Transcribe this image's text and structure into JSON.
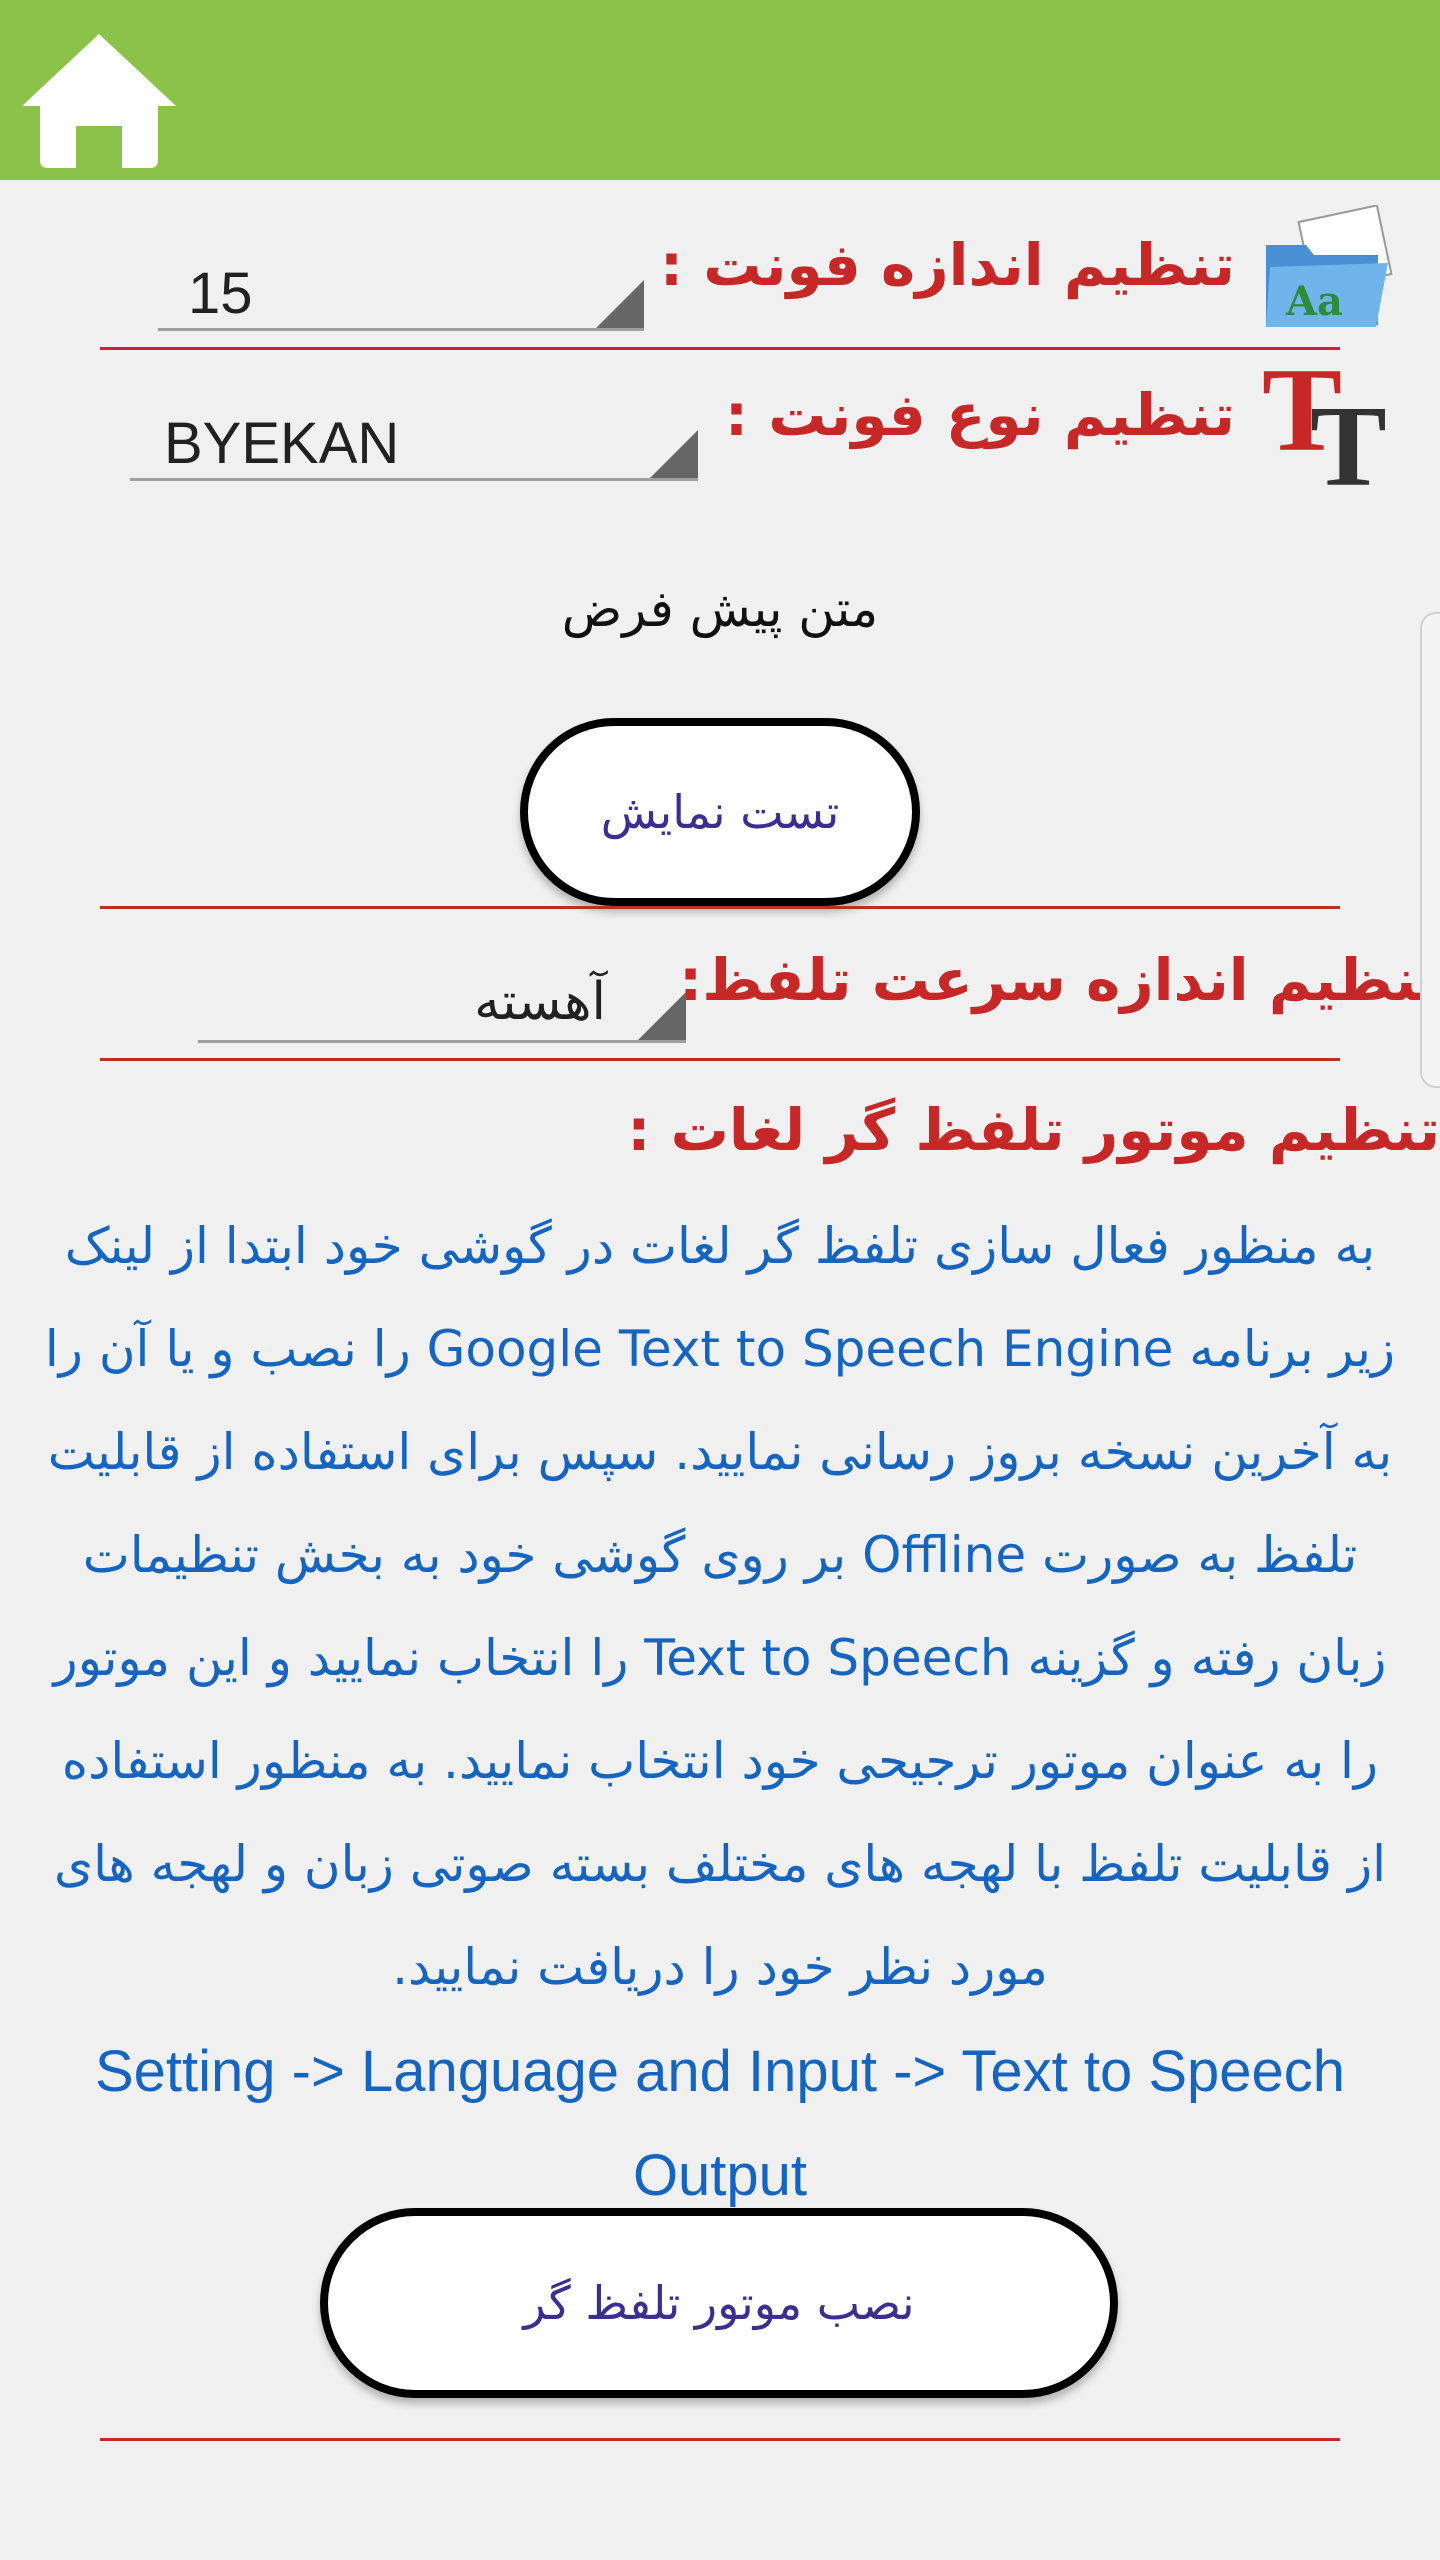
{
  "toolbar": {
    "home_icon": "home-icon",
    "color": "#8bc34a"
  },
  "font_size": {
    "label": "تنظیم اندازه فونت :",
    "value": "15",
    "icon": "folder-font-icon"
  },
  "font_type": {
    "label": "تنظیم نوع فونت :",
    "value": "BYEKAN",
    "icon": "tt-font-icon"
  },
  "preview": {
    "text": "متن پیش فرض",
    "button_label": "تست نمایش"
  },
  "speech_rate": {
    "label": "تنظیم اندازه سرعت تلفظ:",
    "value": "آهسته"
  },
  "tts_engine": {
    "label": "تنظیم موتور تلفظ گر لغات :",
    "info_text": "به منظور فعال سازی تلفظ گر لغات در گوشی خود ابتدا از لینک زیر برنامه Google Text to Speech Engine را نصب و یا آن را به آخرین نسخه بروز رسانی نمایید. سپس برای استفاده از قابلیت تلفظ به صورت Offline بر روی گوشی خود به بخش تنظیمات زبان رفته و گزینه Text to Speech را انتخاب نمایید و این موتور را به عنوان موتور ترجیحی خود انتخاب نمایید. به منظور استفاده از قابلیت تلفظ با لهجه های مختلف بسته صوتی زبان و لهجه های مورد نظر خود را دریافت نمایید.",
    "settings_path": "Setting -> Language and Input -> Text to Speech Output",
    "install_button_label": "نصب موتور تلفظ گر"
  },
  "colors": {
    "label_red": "#c62828",
    "info_blue": "#1565c0",
    "button_text": "#3a2f8f"
  }
}
